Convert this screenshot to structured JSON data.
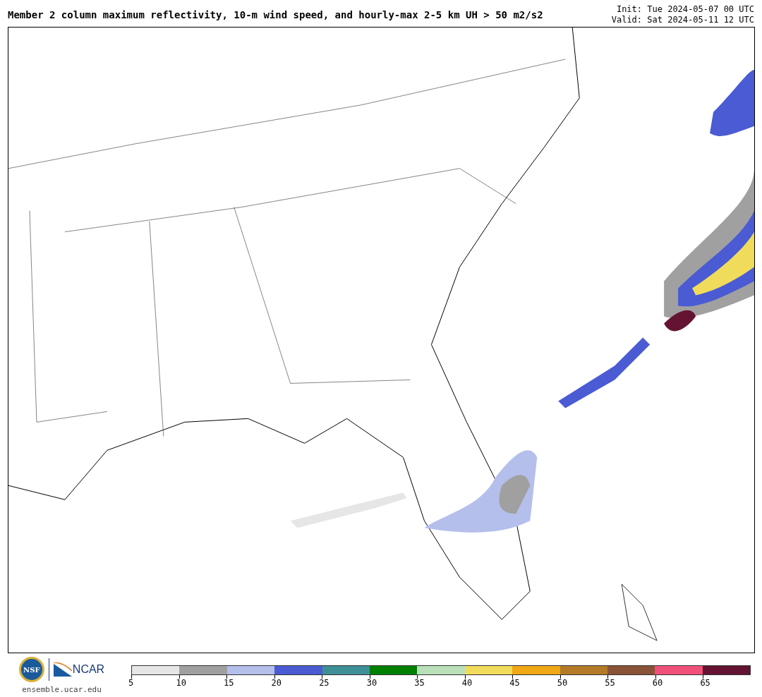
{
  "title": "Member 2 column maximum reflectivity, 10-m wind speed, and hourly-max 2-5 km UH > 50 m2/s2",
  "init": "Init: Tue 2024-05-07 00 UTC",
  "valid": "Valid: Sat 2024-05-11 12 UTC",
  "logos": {
    "nsf": "NSF",
    "ncar": "NCAR",
    "url": "ensemble.ucar.edu"
  },
  "colorbar": {
    "segments": [
      {
        "color": "#e6e6e6"
      },
      {
        "color": "#a0a0a0"
      },
      {
        "color": "#b4bfec"
      },
      {
        "color": "#4a5bd4"
      },
      {
        "color": "#3f8f96"
      },
      {
        "color": "#008000"
      },
      {
        "color": "#b9e0b9"
      },
      {
        "color": "#f0dc5a"
      },
      {
        "color": "#f0a814"
      },
      {
        "color": "#b47a28"
      },
      {
        "color": "#8a5236"
      },
      {
        "color": "#f0507a"
      },
      {
        "color": "#641432"
      }
    ],
    "ticks": [
      "5",
      "10",
      "15",
      "20",
      "25",
      "30",
      "35",
      "40",
      "45",
      "50",
      "55",
      "60",
      "65"
    ]
  }
}
